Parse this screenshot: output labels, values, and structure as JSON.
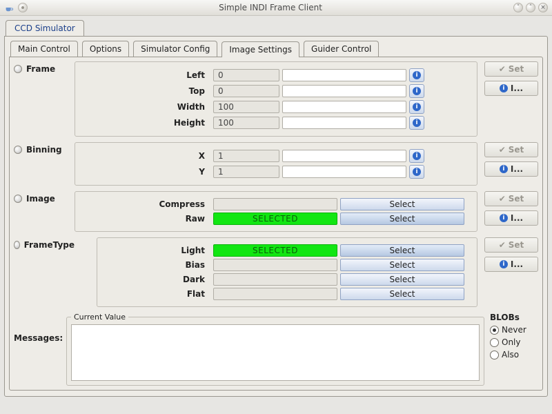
{
  "window": {
    "title": "Simple INDI Frame Client"
  },
  "outer_tab": "CCD Simulator",
  "inner_tabs": [
    "Main Control",
    "Options",
    "Simulator Config",
    "Image Settings",
    "Guider Control"
  ],
  "inner_tab_active": 3,
  "side": {
    "set": "Set",
    "info": "I..."
  },
  "info_tip": "i",
  "frame": {
    "title": "Frame",
    "rows": [
      {
        "label": "Left",
        "value": "0"
      },
      {
        "label": "Top",
        "value": "0"
      },
      {
        "label": "Width",
        "value": "100"
      },
      {
        "label": "Height",
        "value": "100"
      }
    ]
  },
  "binning": {
    "title": "Binning",
    "rows": [
      {
        "label": "X",
        "value": "1"
      },
      {
        "label": "Y",
        "value": "1"
      }
    ]
  },
  "image": {
    "title": "Image",
    "rows": [
      {
        "label": "Compress",
        "status": "",
        "button": "Select"
      },
      {
        "label": "Raw",
        "status": "SELECTED",
        "button": "Select"
      }
    ]
  },
  "frametype": {
    "title": "FrameType",
    "rows": [
      {
        "label": "Light",
        "status": "SELECTED",
        "button": "Select"
      },
      {
        "label": "Bias",
        "status": "",
        "button": "Select"
      },
      {
        "label": "Dark",
        "status": "",
        "button": "Select"
      },
      {
        "label": "Flat",
        "status": "",
        "button": "Select"
      }
    ]
  },
  "footer": {
    "messages_label": "Messages:",
    "current_value_legend": "Current Value",
    "blobs_title": "BLOBs",
    "blobs_options": [
      "Never",
      "Only",
      "Also"
    ],
    "blobs_selected": 0
  }
}
